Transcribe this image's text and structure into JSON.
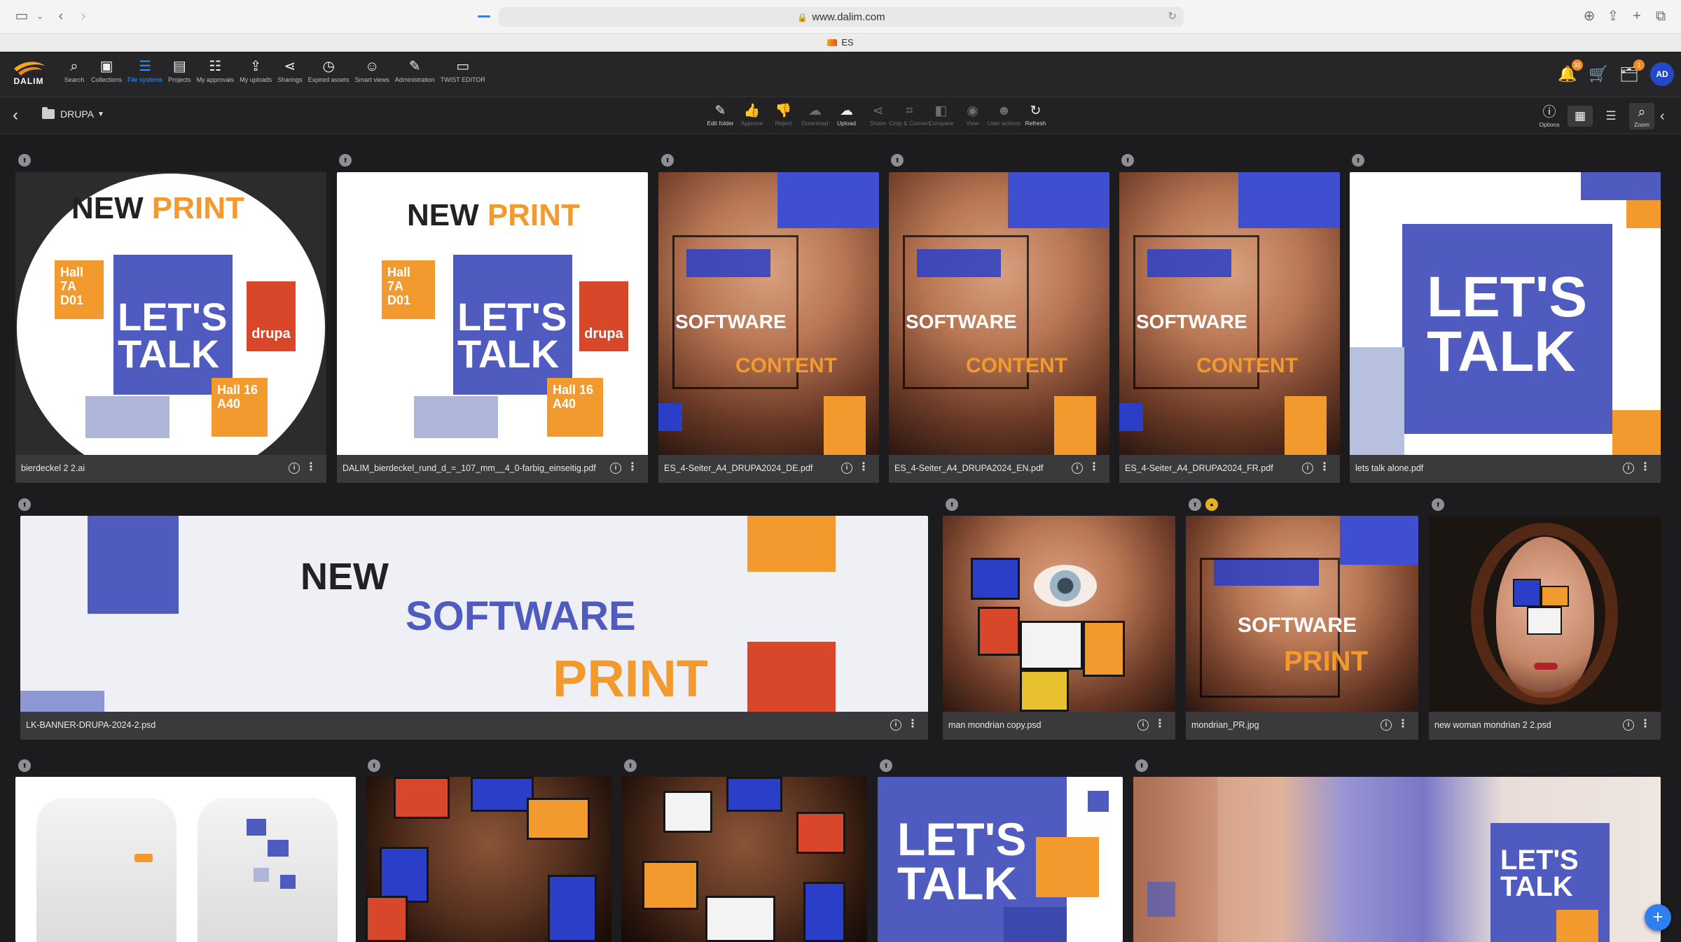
{
  "browser": {
    "url": "www.dalim.com",
    "tab_title": "ES"
  },
  "nav": {
    "items": [
      {
        "label": "Search",
        "icon": "search-icon"
      },
      {
        "label": "Collections",
        "icon": "collections-icon"
      },
      {
        "label": "File systems",
        "icon": "database-icon",
        "active": true
      },
      {
        "label": "Projects",
        "icon": "briefcase-icon"
      },
      {
        "label": "My approvals",
        "icon": "checklist-icon"
      },
      {
        "label": "My uploads",
        "icon": "upload-tray-icon"
      },
      {
        "label": "Sharings",
        "icon": "share-icon"
      },
      {
        "label": "Expired assets",
        "icon": "clock-icon"
      },
      {
        "label": "Smart views",
        "icon": "smart-view-icon"
      },
      {
        "label": "Administration",
        "icon": "wrench-icon"
      },
      {
        "label": "TWIST EDITOR",
        "icon": "monitor-icon"
      }
    ],
    "badges": {
      "notifications": "31",
      "tasks": "1"
    },
    "avatar_initials": "AD"
  },
  "toolbar": {
    "folder_name": "DRUPA",
    "actions": [
      {
        "label": "Edit folder",
        "icon": "pencil-icon",
        "enabled": true
      },
      {
        "label": "Approve",
        "icon": "thumbs-up-icon",
        "enabled": false
      },
      {
        "label": "Reject",
        "icon": "thumbs-down-icon",
        "enabled": false
      },
      {
        "label": "Download",
        "icon": "cloud-download-icon",
        "enabled": false
      },
      {
        "label": "Upload",
        "icon": "cloud-upload-icon",
        "enabled": true
      },
      {
        "label": "Share",
        "icon": "share-icon",
        "enabled": false
      },
      {
        "label": "Crop & Convert",
        "icon": "crop-icon",
        "enabled": false
      },
      {
        "label": "Compare",
        "icon": "compare-icon",
        "enabled": false
      },
      {
        "label": "View",
        "icon": "eye-icon",
        "enabled": false
      },
      {
        "label": "User actions",
        "icon": "users-icon",
        "enabled": false
      },
      {
        "label": "Refresh",
        "icon": "refresh-icon",
        "enabled": true
      }
    ],
    "options_label": "Options",
    "zoom_label": "Zoom"
  },
  "assets": [
    {
      "name": "bierdeckel 2 2.ai"
    },
    {
      "name": "DALIM_bierdeckel_rund_d_=_107_mm__4_0-farbig_einseitig.pdf"
    },
    {
      "name": "ES_4-Seiter_A4_DRUPA2024_DE.pdf"
    },
    {
      "name": "ES_4-Seiter_A4_DRUPA2024_EN.pdf"
    },
    {
      "name": "ES_4-Seiter_A4_DRUPA2024_FR.pdf"
    },
    {
      "name": "lets talk alone.pdf"
    },
    {
      "name": "LK-BANNER-DRUPA-2024-2.psd"
    },
    {
      "name": "man mondrian copy.psd"
    },
    {
      "name": "mondrian_PR.jpg"
    },
    {
      "name": "new woman mondrian 2 2.psd"
    }
  ],
  "thumb_text": {
    "new": "NEW",
    "software": "SOFTWARE",
    "print": "PRINT",
    "lets": "LET'S",
    "talk": "TALK",
    "drupa": "drupa",
    "hall_a": "Hall 7A D01",
    "hall_b": "Hall 16 A40",
    "new_content": "CONTENT"
  },
  "colors": {
    "accent_blue": "#3d8df5",
    "brand_purple": "#4f5bbf",
    "brand_orange": "#f29a2e",
    "brand_red": "#d9472b"
  }
}
